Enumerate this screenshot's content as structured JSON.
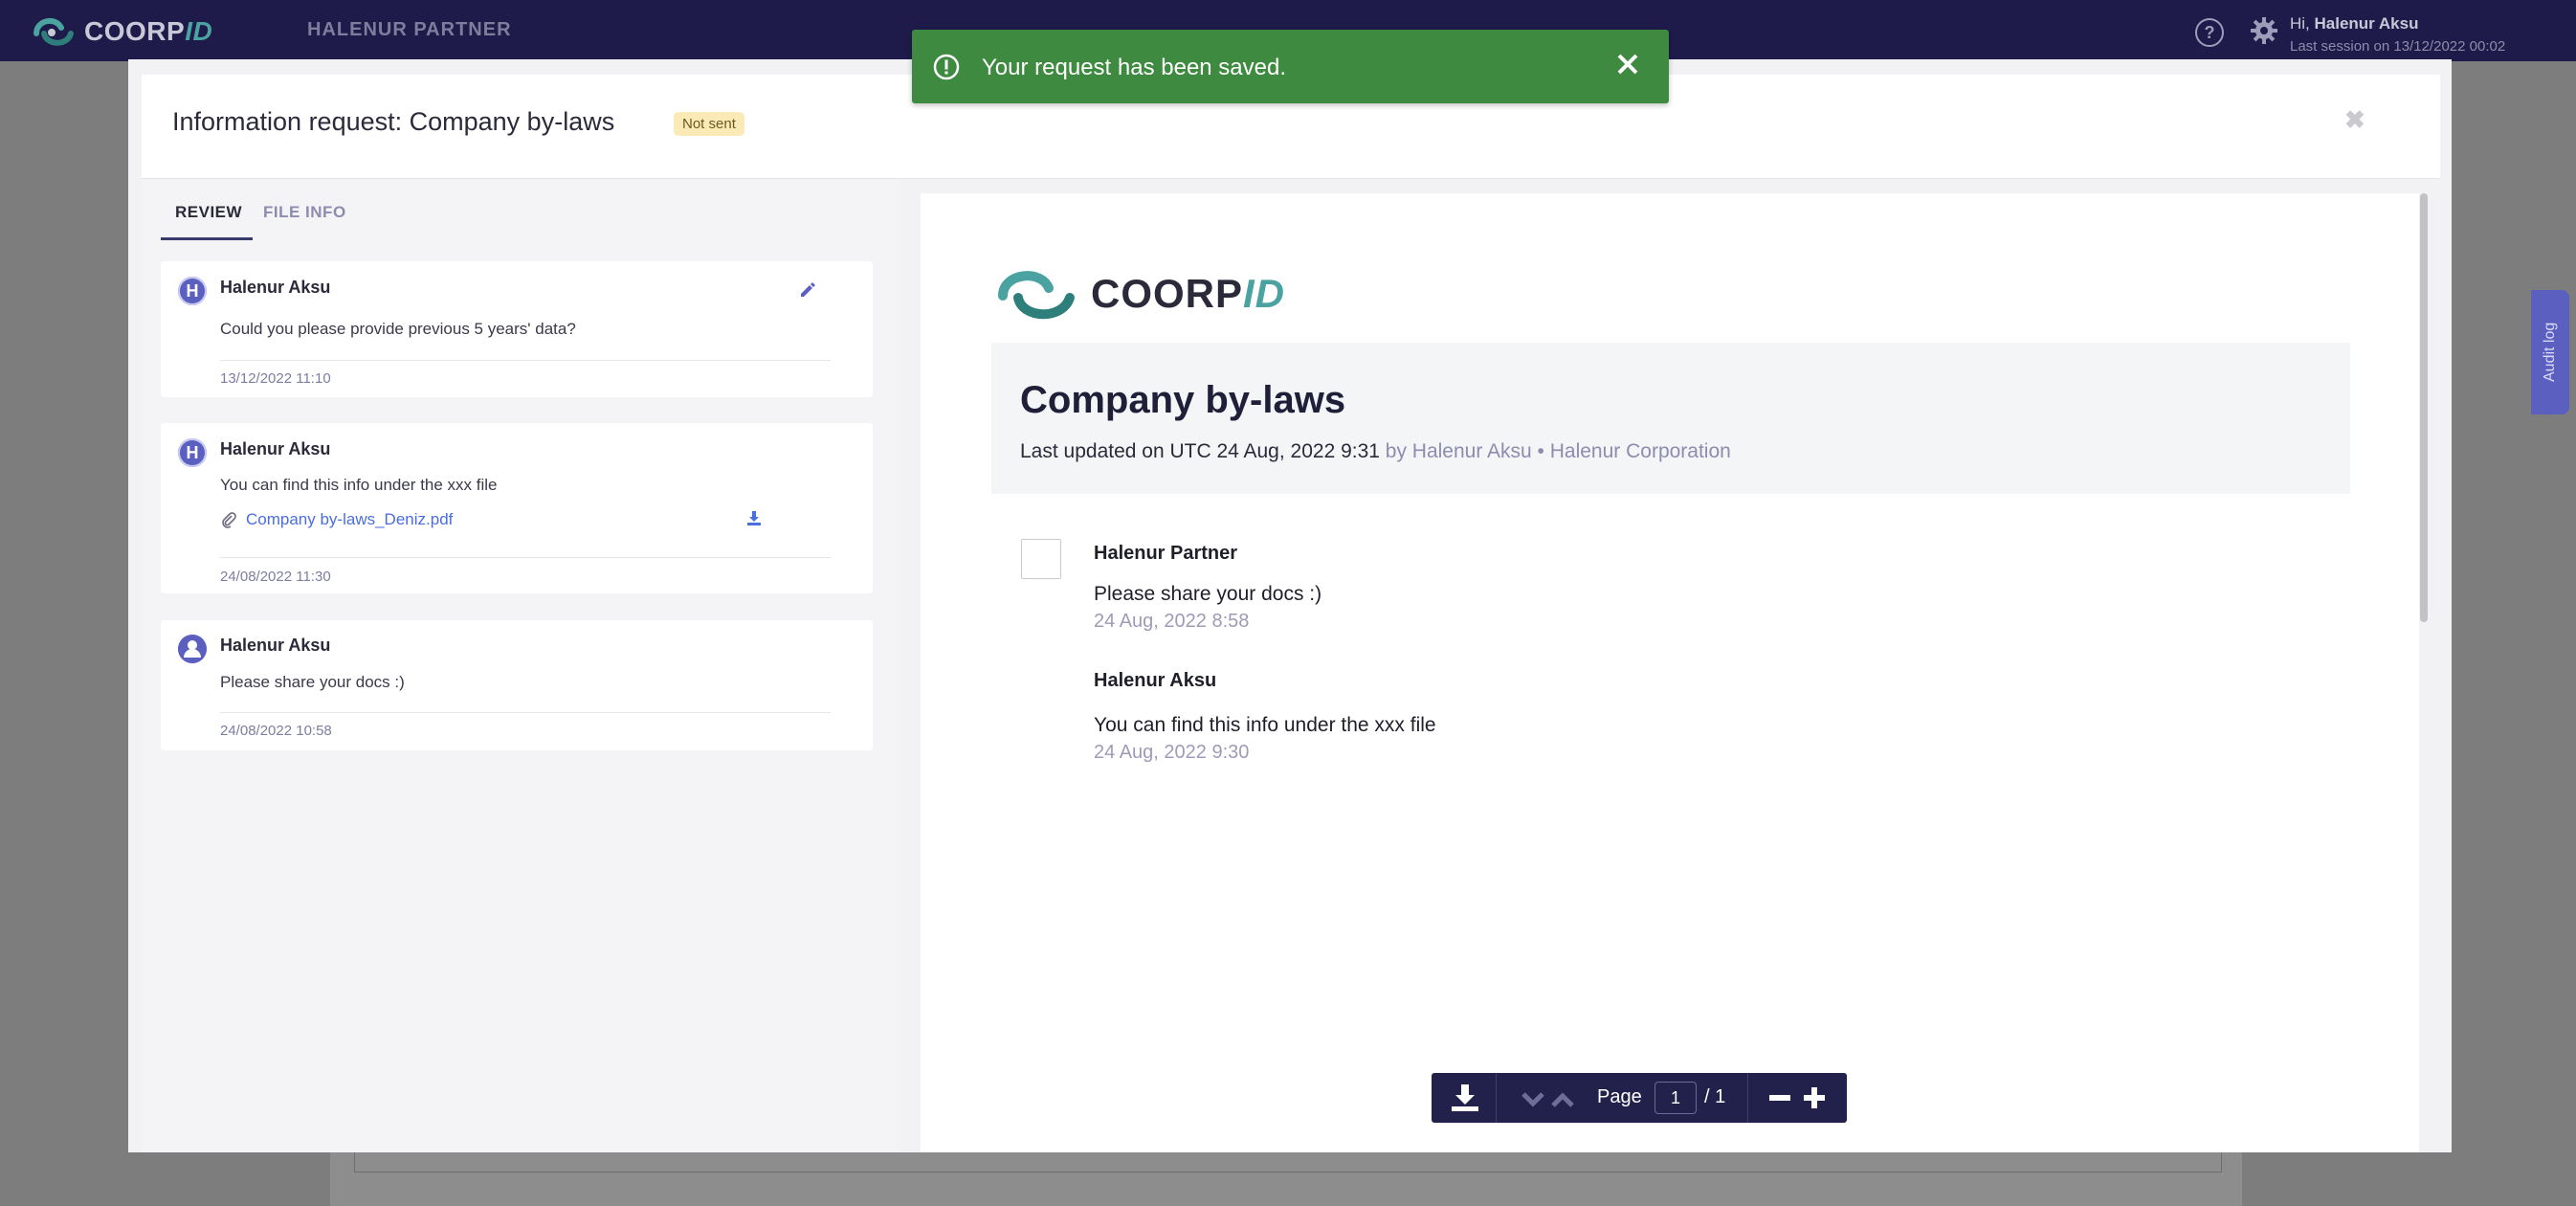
{
  "topbar": {
    "brand_main": "COORP",
    "brand_id": "ID",
    "partner": "HALENUR PARTNER",
    "greeting_prefix": "Hi, ",
    "user_name": "Halenur Aksu",
    "last_session": "Last session on  13/12/2022 00:02"
  },
  "audit_tab": {
    "label": "Audit log"
  },
  "toast": {
    "message": "Your request has been saved."
  },
  "modal": {
    "title": "Information request: Company by-laws",
    "status": "Not sent",
    "tabs": [
      {
        "label": "REVIEW",
        "active": true
      },
      {
        "label": "FILE INFO",
        "active": false
      }
    ],
    "comments": [
      {
        "avatar": "H",
        "author": "Halenur Aksu",
        "text": "Could you please provide previous 5 years' data?",
        "date": "13/12/2022 11:10"
      },
      {
        "avatar": "H",
        "author": "Halenur Aksu",
        "text": "You can find this info under the xxx file",
        "attachment": "Company by-laws_Deniz.pdf",
        "date": "24/08/2022 11:30"
      },
      {
        "avatar": "",
        "author": "Halenur Aksu",
        "text": "Please share your docs :)",
        "date": "24/08/2022 10:58"
      }
    ]
  },
  "document": {
    "brand_main": "COORP",
    "brand_id": "ID",
    "title": "Company by-laws",
    "updated_prefix": "Last updated on UTC 24 Aug, 2022 9:31",
    "updated_suffix": " by Halenur Aksu • Halenur Corporation",
    "messages": [
      {
        "author": "Halenur Partner",
        "text": "Please share your docs :)",
        "date": "24 Aug, 2022 8:58"
      },
      {
        "author": "Halenur Aksu",
        "text": "You can find this info under the xxx file",
        "date": "24 Aug, 2022 9:30"
      }
    ]
  },
  "toolbar": {
    "page_label": "Page",
    "current_page": "1",
    "total_pages": "/ 1"
  },
  "colors": {
    "topbar": "#1e1b4b",
    "accent": "#5a5fc0",
    "brand_teal": "#4aa3a0",
    "toast": "#3f8a41",
    "badge": "#fbeab5",
    "link": "#4a6ee0"
  }
}
